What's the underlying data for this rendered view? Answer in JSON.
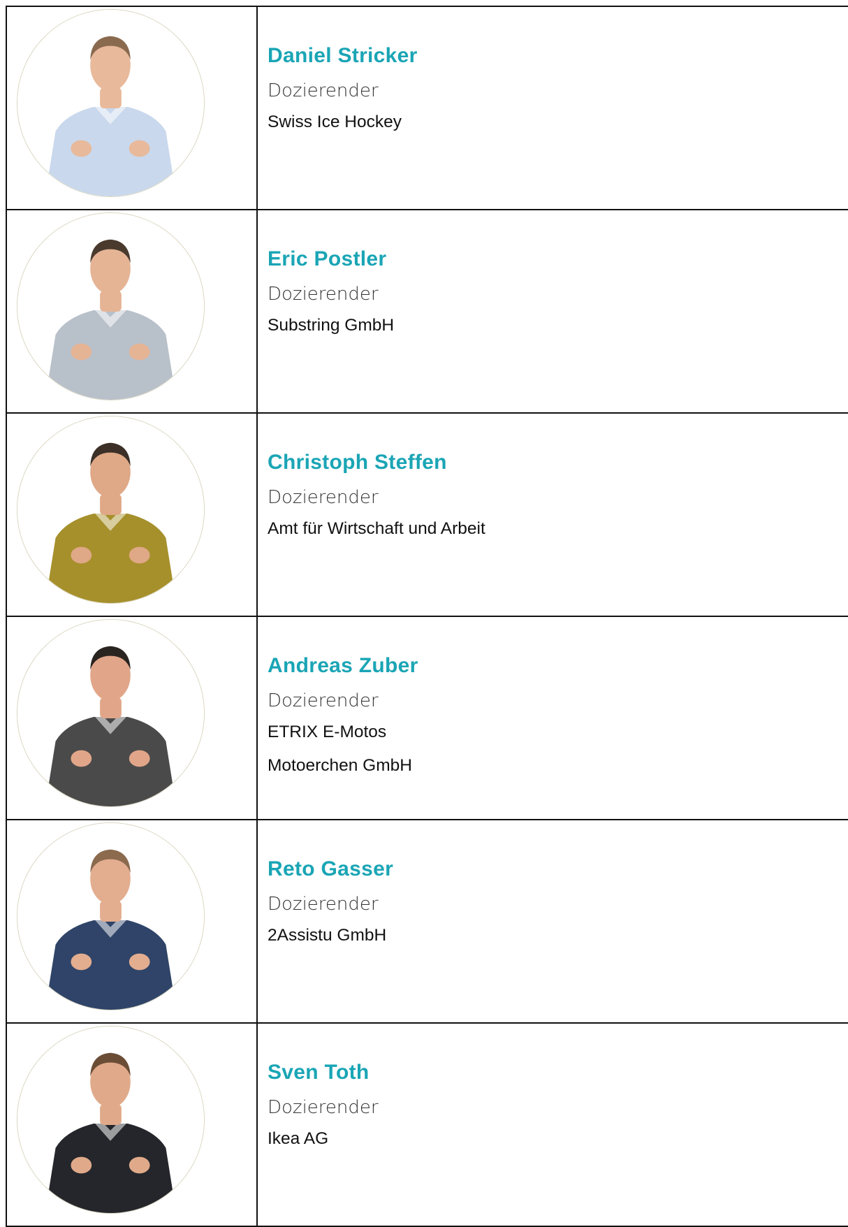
{
  "colors": {
    "accent": "#1aa5b5",
    "border": "#111111",
    "avatar_ring": "#d9d5bf"
  },
  "people": [
    {
      "name": "Daniel Stricker",
      "role": "Dozierender",
      "orgs": [
        "Swiss Ice Hockey"
      ],
      "shirt": "#c9d8ec",
      "hair": "#8a6a4f",
      "skin": "#e8b99b"
    },
    {
      "name": "Eric Postler",
      "role": "Dozierender",
      "orgs": [
        "Substring GmbH"
      ],
      "shirt": "#b8c0ca",
      "hair": "#4a3a2e",
      "skin": "#e5b495"
    },
    {
      "name": "Christoph Steffen",
      "role": "Dozierender",
      "orgs": [
        "Amt für Wirtschaft und Arbeit"
      ],
      "shirt": "#a6902c",
      "hair": "#3b2f27",
      "skin": "#dfa886"
    },
    {
      "name": "Andreas Zuber",
      "role": "Dozierender",
      "orgs": [
        "ETRIX E-Motos",
        "Motoerchen GmbH"
      ],
      "shirt": "#4a4a4a",
      "hair": "#2a2420",
      "skin": "#e1a689"
    },
    {
      "name": "Reto Gasser",
      "role": "Dozierender",
      "orgs": [
        "2Assistu GmbH"
      ],
      "shirt": "#2f4468",
      "hair": "#8b6a4e",
      "skin": "#e3ad8f"
    },
    {
      "name": "Sven Toth",
      "role": "Dozierender",
      "orgs": [
        "Ikea AG"
      ],
      "shirt": "#24262b",
      "hair": "#6b4d36",
      "skin": "#e0aa8a"
    }
  ]
}
